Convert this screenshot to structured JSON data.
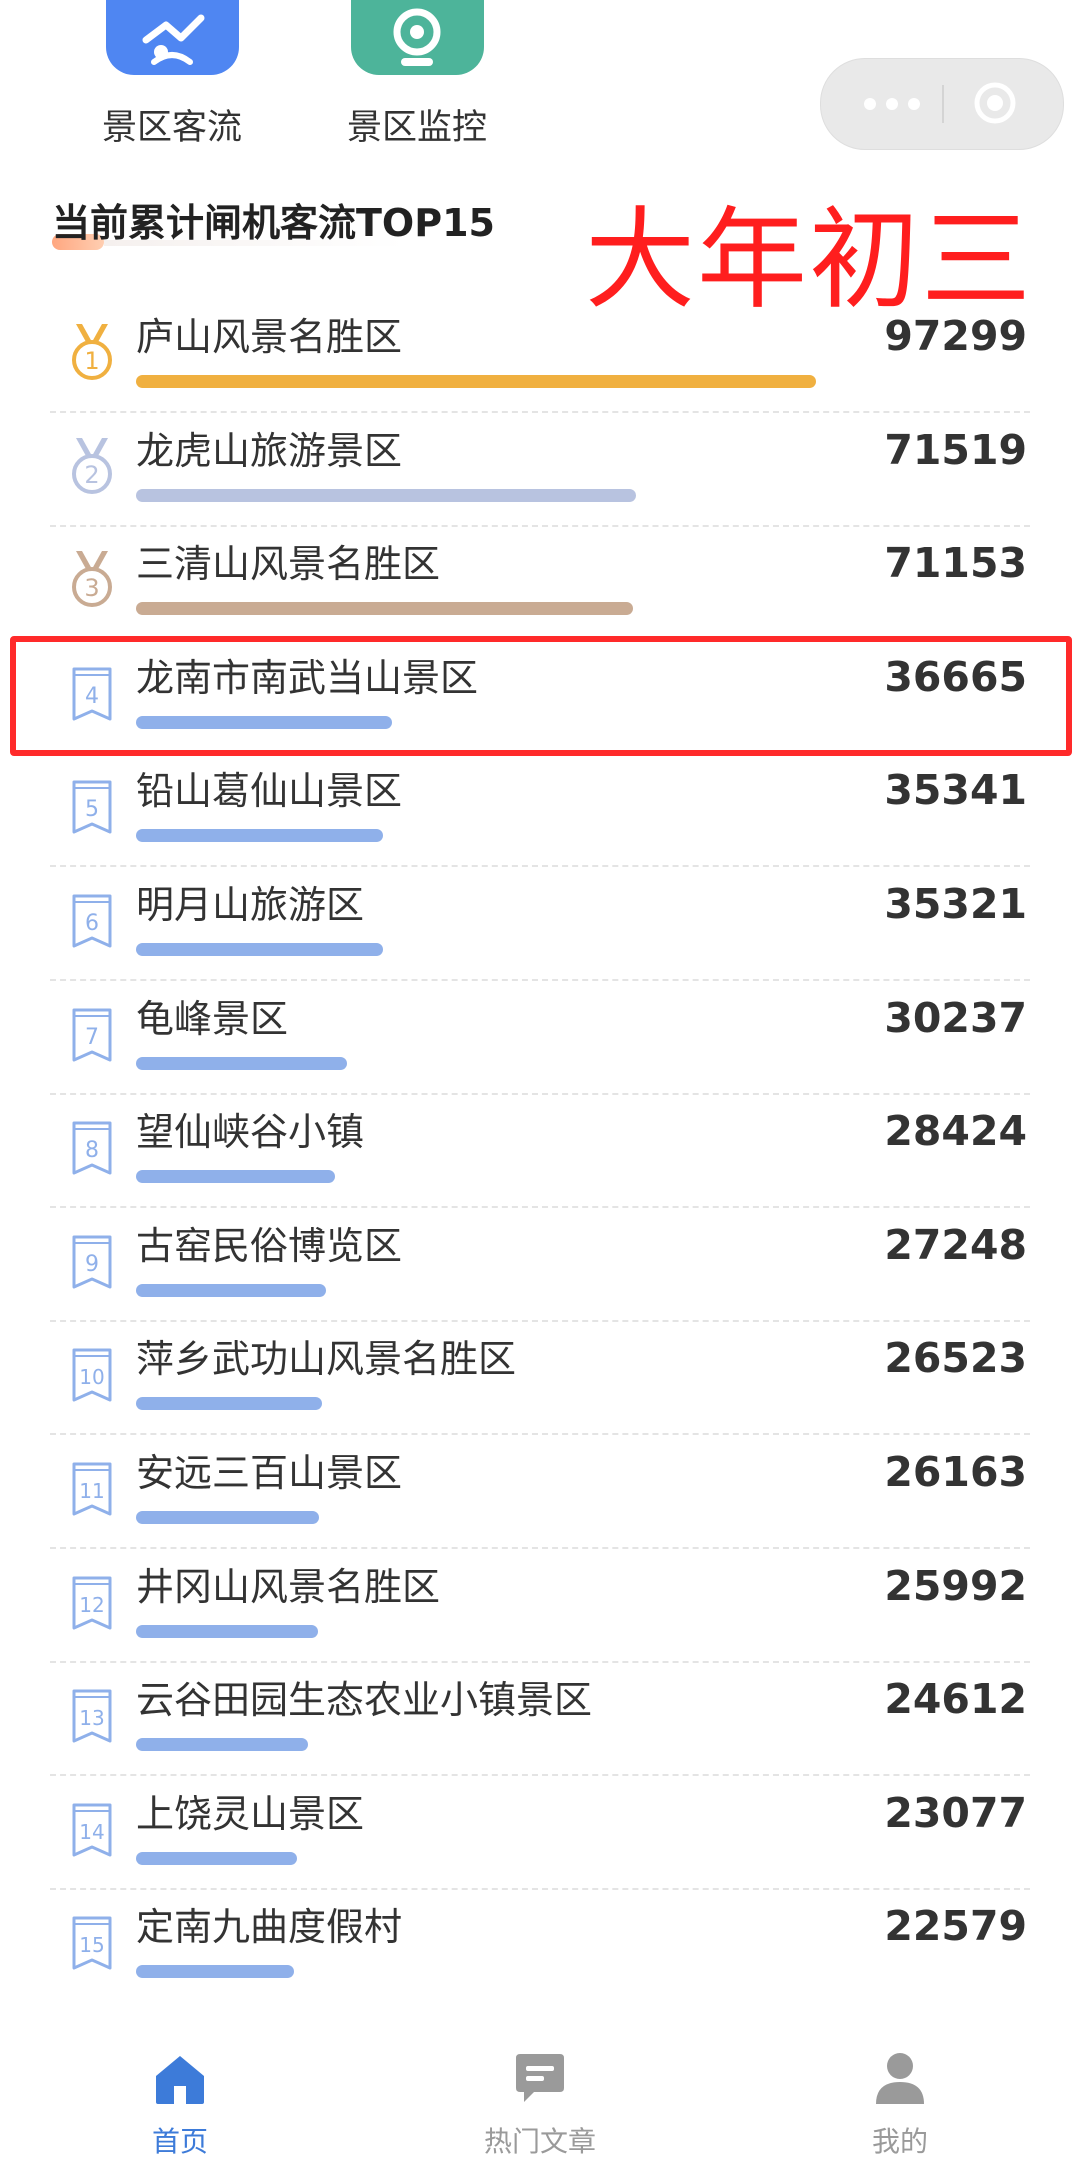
{
  "shortcuts": [
    {
      "label": "景区客流",
      "icon": "scenic-flow-icon"
    },
    {
      "label": "景区监控",
      "icon": "camera-icon"
    }
  ],
  "capsule": {
    "more_icon": "more-dots-icon",
    "close_icon": "target-close-icon"
  },
  "heading": {
    "title": "当前累计闸机客流TOP15"
  },
  "annotation": "大年初三",
  "colors": {
    "gold": "#f0b040",
    "silver": "#b8c3e0",
    "bronze": "#c9ab93",
    "blue_bar": "#8fb0ea",
    "highlight": "#ff2a2a",
    "tab_active": "#3d7bd9",
    "tab_inactive": "#9a9a9a"
  },
  "ranking": [
    {
      "rank": "1",
      "name": "庐山风景名胜区",
      "value": "97299",
      "share": 1.0,
      "badge": "gold-medal-icon",
      "color": "#f0b040"
    },
    {
      "rank": "2",
      "name": "龙虎山旅游景区",
      "value": "71519",
      "share": 0.735,
      "badge": "silver-medal-icon",
      "color": "#b8c3e0"
    },
    {
      "rank": "3",
      "name": "三清山风景名胜区",
      "value": "71153",
      "share": 0.731,
      "badge": "bronze-medal-icon",
      "color": "#c9ab93"
    },
    {
      "rank": "4",
      "name": "龙南市南武当山景区",
      "value": "36665",
      "share": 0.377,
      "badge": "rank-ribbon-icon",
      "color": "#8fb0ea"
    },
    {
      "rank": "5",
      "name": "铅山葛仙山景区",
      "value": "35341",
      "share": 0.363,
      "badge": "rank-ribbon-icon",
      "color": "#8fb0ea"
    },
    {
      "rank": "6",
      "name": "明月山旅游区",
      "value": "35321",
      "share": 0.363,
      "badge": "rank-ribbon-icon",
      "color": "#8fb0ea"
    },
    {
      "rank": "7",
      "name": "龟峰景区",
      "value": "30237",
      "share": 0.311,
      "badge": "rank-ribbon-icon",
      "color": "#8fb0ea"
    },
    {
      "rank": "8",
      "name": "望仙峡谷小镇",
      "value": "28424",
      "share": 0.292,
      "badge": "rank-ribbon-icon",
      "color": "#8fb0ea"
    },
    {
      "rank": "9",
      "name": "古窑民俗博览区",
      "value": "27248",
      "share": 0.28,
      "badge": "rank-ribbon-icon",
      "color": "#8fb0ea"
    },
    {
      "rank": "10",
      "name": "萍乡武功山风景名胜区",
      "value": "26523",
      "share": 0.273,
      "badge": "rank-ribbon-icon",
      "color": "#8fb0ea"
    },
    {
      "rank": "11",
      "name": "安远三百山景区",
      "value": "26163",
      "share": 0.269,
      "badge": "rank-ribbon-icon",
      "color": "#8fb0ea"
    },
    {
      "rank": "12",
      "name": "井冈山风景名胜区",
      "value": "25992",
      "share": 0.267,
      "badge": "rank-ribbon-icon",
      "color": "#8fb0ea"
    },
    {
      "rank": "13",
      "name": "云谷田园生态农业小镇景区",
      "value": "24612",
      "share": 0.253,
      "badge": "rank-ribbon-icon",
      "color": "#8fb0ea"
    },
    {
      "rank": "14",
      "name": "上饶灵山景区",
      "value": "23077",
      "share": 0.237,
      "badge": "rank-ribbon-icon",
      "color": "#8fb0ea"
    },
    {
      "rank": "15",
      "name": "定南九曲度假村",
      "value": "22579",
      "share": 0.232,
      "badge": "rank-ribbon-icon",
      "color": "#8fb0ea"
    }
  ],
  "tabs": [
    {
      "label": "首页",
      "icon": "home-icon",
      "active": true
    },
    {
      "label": "热门文章",
      "icon": "article-bubble-icon",
      "active": false
    },
    {
      "label": "我的",
      "icon": "profile-icon",
      "active": false
    }
  ]
}
